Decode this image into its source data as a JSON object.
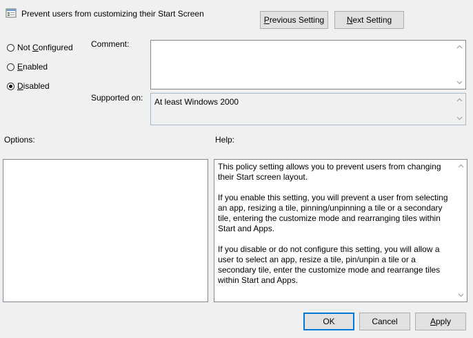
{
  "window": {
    "title": "Prevent users from customizing their Start Screen",
    "icon": "policy-icon"
  },
  "nav": {
    "previous_pre": "",
    "previous_ul": "P",
    "previous_post": "revious Setting",
    "next_pre": "",
    "next_ul": "N",
    "next_post": "ext Setting"
  },
  "state": {
    "options": [
      {
        "pre": "Not ",
        "ul": "C",
        "post": "onfigured",
        "checked": false
      },
      {
        "pre": "",
        "ul": "E",
        "post": "nabled",
        "checked": false
      },
      {
        "pre": "",
        "ul": "D",
        "post": "isabled",
        "checked": true
      }
    ]
  },
  "comment": {
    "label": "Comment:",
    "value": ""
  },
  "supported": {
    "label": "Supported on:",
    "value": "At least Windows 2000"
  },
  "options_panel": {
    "label": "Options:"
  },
  "help_panel": {
    "label": "Help:",
    "paragraphs": [
      "This policy setting allows you to prevent users from changing their Start screen layout.",
      "If you enable this setting, you will prevent a user from selecting an app, resizing a tile, pinning/unpinning a tile or a secondary tile, entering the customize mode and rearranging tiles within Start and Apps.",
      "If you disable or do not configure this setting, you will allow a user to select an app, resize a tile, pin/unpin a tile or a secondary tile, enter the customize mode and rearrange tiles within Start and Apps."
    ]
  },
  "footer": {
    "ok_label": "OK",
    "cancel_label": "Cancel",
    "apply_pre": "",
    "apply_ul": "A",
    "apply_post": "pply"
  },
  "colors": {
    "background": "#f0f0f0",
    "default_button_border": "#0078d7"
  }
}
